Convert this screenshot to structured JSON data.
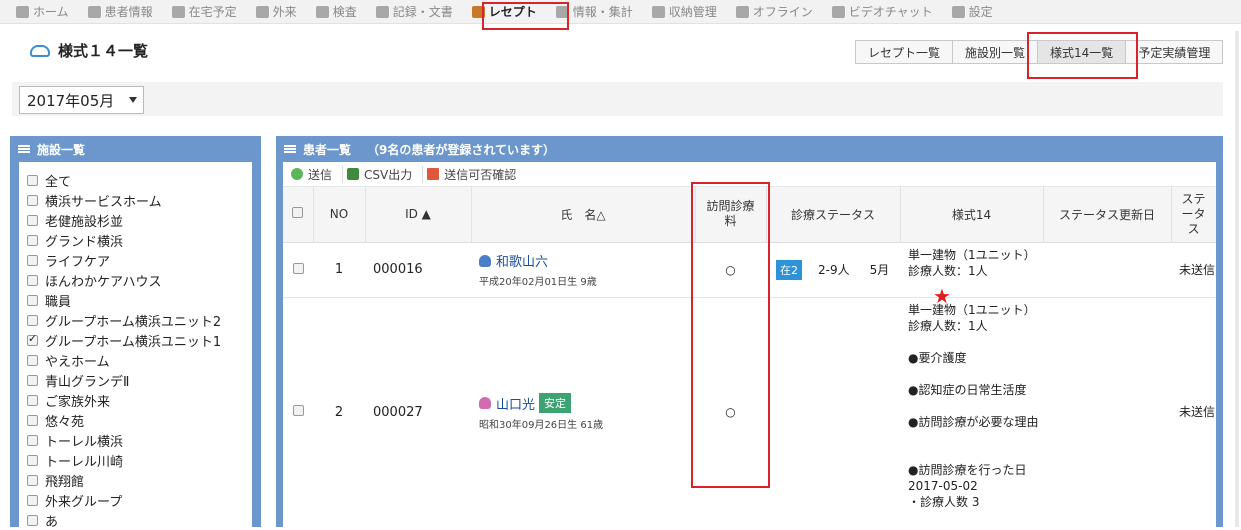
{
  "nav": {
    "items": [
      {
        "label": "ホーム",
        "icon": "home-icon"
      },
      {
        "label": "患者情報",
        "icon": "patient-icon"
      },
      {
        "label": "在宅予定",
        "icon": "schedule-icon"
      },
      {
        "label": "外来",
        "icon": "outpatient-icon"
      },
      {
        "label": "検査",
        "icon": "exam-icon"
      },
      {
        "label": "記録・文書",
        "icon": "document-icon"
      },
      {
        "label": "レセプト",
        "icon": "receipt-icon",
        "active": true
      },
      {
        "label": "情報・集計",
        "icon": "stats-icon"
      },
      {
        "label": "収納管理",
        "icon": "billing-icon"
      },
      {
        "label": "オフライン",
        "icon": "offline-icon"
      },
      {
        "label": "ビデオチャット",
        "icon": "video-icon"
      },
      {
        "label": "設定",
        "icon": "gear-icon"
      }
    ]
  },
  "page": {
    "title": "様式１４一覧"
  },
  "tabs": [
    {
      "label": "レセプト一覧"
    },
    {
      "label": "施設別一覧"
    },
    {
      "label": "様式14一覧",
      "active": true
    },
    {
      "label": "予定実績管理"
    }
  ],
  "month": {
    "selected": "2017年05月"
  },
  "facility": {
    "header": "施設一覧",
    "items": [
      {
        "label": "全て",
        "checked": false
      },
      {
        "label": "横浜サービスホーム",
        "checked": false
      },
      {
        "label": "老健施設杉並",
        "checked": false
      },
      {
        "label": "グランド横浜",
        "checked": false
      },
      {
        "label": "ライフケア",
        "checked": false
      },
      {
        "label": "ほんわかケアハウス",
        "checked": false
      },
      {
        "label": "職員",
        "checked": false
      },
      {
        "label": "グループホーム横浜ユニット2",
        "checked": false
      },
      {
        "label": "グループホーム横浜ユニット1",
        "checked": true
      },
      {
        "label": "やえホーム",
        "checked": false
      },
      {
        "label": "青山グランデⅡ",
        "checked": false
      },
      {
        "label": "ご家族外来",
        "checked": false
      },
      {
        "label": "悠々苑",
        "checked": false
      },
      {
        "label": "トーレル横浜",
        "checked": false
      },
      {
        "label": "トーレル川崎",
        "checked": false
      },
      {
        "label": "飛翔館",
        "checked": false
      },
      {
        "label": "外来グループ",
        "checked": false
      },
      {
        "label": "あ",
        "checked": false
      }
    ]
  },
  "patients": {
    "header": "患者一覧",
    "count_text": "（9名の患者が登録されています）",
    "toolbar": {
      "send": "送信",
      "csv": "CSV出力",
      "check": "送信可否確認"
    },
    "columns": {
      "no": "NO",
      "id": "ID ▲",
      "name": "氏　名△",
      "visit": "訪問診療料",
      "status": "診療ステータス",
      "style14": "様式14",
      "updated": "ステータス更新日",
      "send_status": "ステータス"
    },
    "rows": [
      {
        "no": "1",
        "id": "000016",
        "name": "和歌山六",
        "gender": "male",
        "birth": "平成20年02月01日生 9歳",
        "badge": "",
        "visit": "○",
        "status_badge": "在2",
        "status_group": "2-9人",
        "status_month": "5月",
        "style_lines": [
          "単一建物（1ユニット）診療人数：1人"
        ],
        "updated": "",
        "send_status": "未送信"
      },
      {
        "no": "2",
        "id": "000027",
        "name": "山口光",
        "gender": "female",
        "birth": "昭和30年09月26日生 61歳",
        "badge": "安定",
        "visit": "○",
        "status_badge": "",
        "status_group": "",
        "status_month": "",
        "style_lines": [
          "単一建物（1ユニット）診療人数：1人",
          "",
          "●要介護度",
          "",
          "●認知症の日常生活度",
          "",
          "●訪問診療が必要な理由",
          "",
          "",
          "●訪問診療を行った日",
          "2017-05-02",
          "・診療人数 3"
        ],
        "updated": "",
        "send_status": "未送信"
      }
    ]
  },
  "colors": {
    "accent_blue": "#6b97cc",
    "highlight_red": "#d9232a",
    "zai_badge": "#2c93d8",
    "stable_badge": "#3da373",
    "star": "#e01e1e"
  }
}
